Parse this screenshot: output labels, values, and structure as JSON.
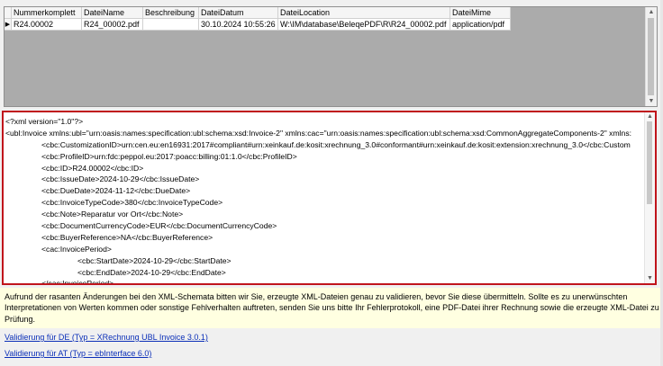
{
  "grid": {
    "columns": [
      "Nummerkomplett",
      "DateiName",
      "Beschreibung",
      "DateiDatum",
      "DateiLocation",
      "DateiMime"
    ],
    "rows": [
      {
        "indicator": "▶",
        "cells": [
          "R24.00002",
          "R24_00002.pdf",
          "",
          "30.10.2024 10:55:26",
          "W:\\IM\\database\\BeleqePDF\\R\\R24_00002.pdf",
          "application/pdf"
        ]
      }
    ]
  },
  "xml": {
    "lines": [
      {
        "indent": 0,
        "text": "<?xml version=\"1.0\"?>"
      },
      {
        "indent": 0,
        "text": "<ubl:Invoice xmlns:ubl=\"urn:oasis:names:specification:ubl:schema:xsd:Invoice-2\" xmlns:cac=\"urn:oasis:names:specification:ubl:schema:xsd:CommonAggregateComponents-2\" xmlns:"
      },
      {
        "indent": 1,
        "text": "<cbc:CustomizationID>urn:cen.eu:en16931:2017#compliant#urn:xeinkauf.de:kosit:xrechnung_3.0#conformant#urn:xeinkauf.de:kosit:extension:xrechnung_3.0</cbc:Custom"
      },
      {
        "indent": 1,
        "text": "<cbc:ProfileID>urn:fdc:peppol.eu:2017:poacc:billing:01:1.0</cbc:ProfileID>"
      },
      {
        "indent": 1,
        "text": "<cbc:ID>R24.00002</cbc:ID>"
      },
      {
        "indent": 1,
        "text": "<cbc:IssueDate>2024-10-29</cbc:IssueDate>"
      },
      {
        "indent": 1,
        "text": "<cbc:DueDate>2024-11-12</cbc:DueDate>"
      },
      {
        "indent": 1,
        "text": "<cbc:InvoiceTypeCode>380</cbc:InvoiceTypeCode>"
      },
      {
        "indent": 1,
        "text": "<cbc:Note>Reparatur vor Ort</cbc:Note>"
      },
      {
        "indent": 1,
        "text": "<cbc:DocumentCurrencyCode>EUR</cbc:DocumentCurrencyCode>"
      },
      {
        "indent": 1,
        "text": "<cbc:BuyerReference>NA</cbc:BuyerReference>"
      },
      {
        "indent": 1,
        "text": "<cac:InvoicePeriod>"
      },
      {
        "indent": 2,
        "text": "<cbc:StartDate>2024-10-29</cbc:StartDate>"
      },
      {
        "indent": 2,
        "text": "<cbc:EndDate>2024-10-29</cbc:EndDate>"
      },
      {
        "indent": 1,
        "text": "</cac:InvoicePeriod>"
      }
    ]
  },
  "info": {
    "text": "Aufrund der rasanten Änderungen bei den XML-Schemata bitten wir Sie, erzeugte XML-Dateien genau zu validieren, bevor Sie diese übermitteln. Sollte es zu unerwünschten Interpretationen von Werten kommen oder sonstige Fehlverhalten auftreten, senden Sie uns bitte Ihr Fehlerprotokoll, eine PDF-Datei ihrer Rechnung sowie die erzeugte XML-Datei zu Prüfung."
  },
  "links": {
    "de": "Validierung für DE (Typ = XRechnung UBL Invoice 3.0.1)",
    "at": "Validierung für AT (Typ = ebInterface 6.0)"
  },
  "colors": {
    "highlight_border": "#c0141c",
    "info_background": "#ffffe1",
    "link": "#0b2fb8"
  }
}
